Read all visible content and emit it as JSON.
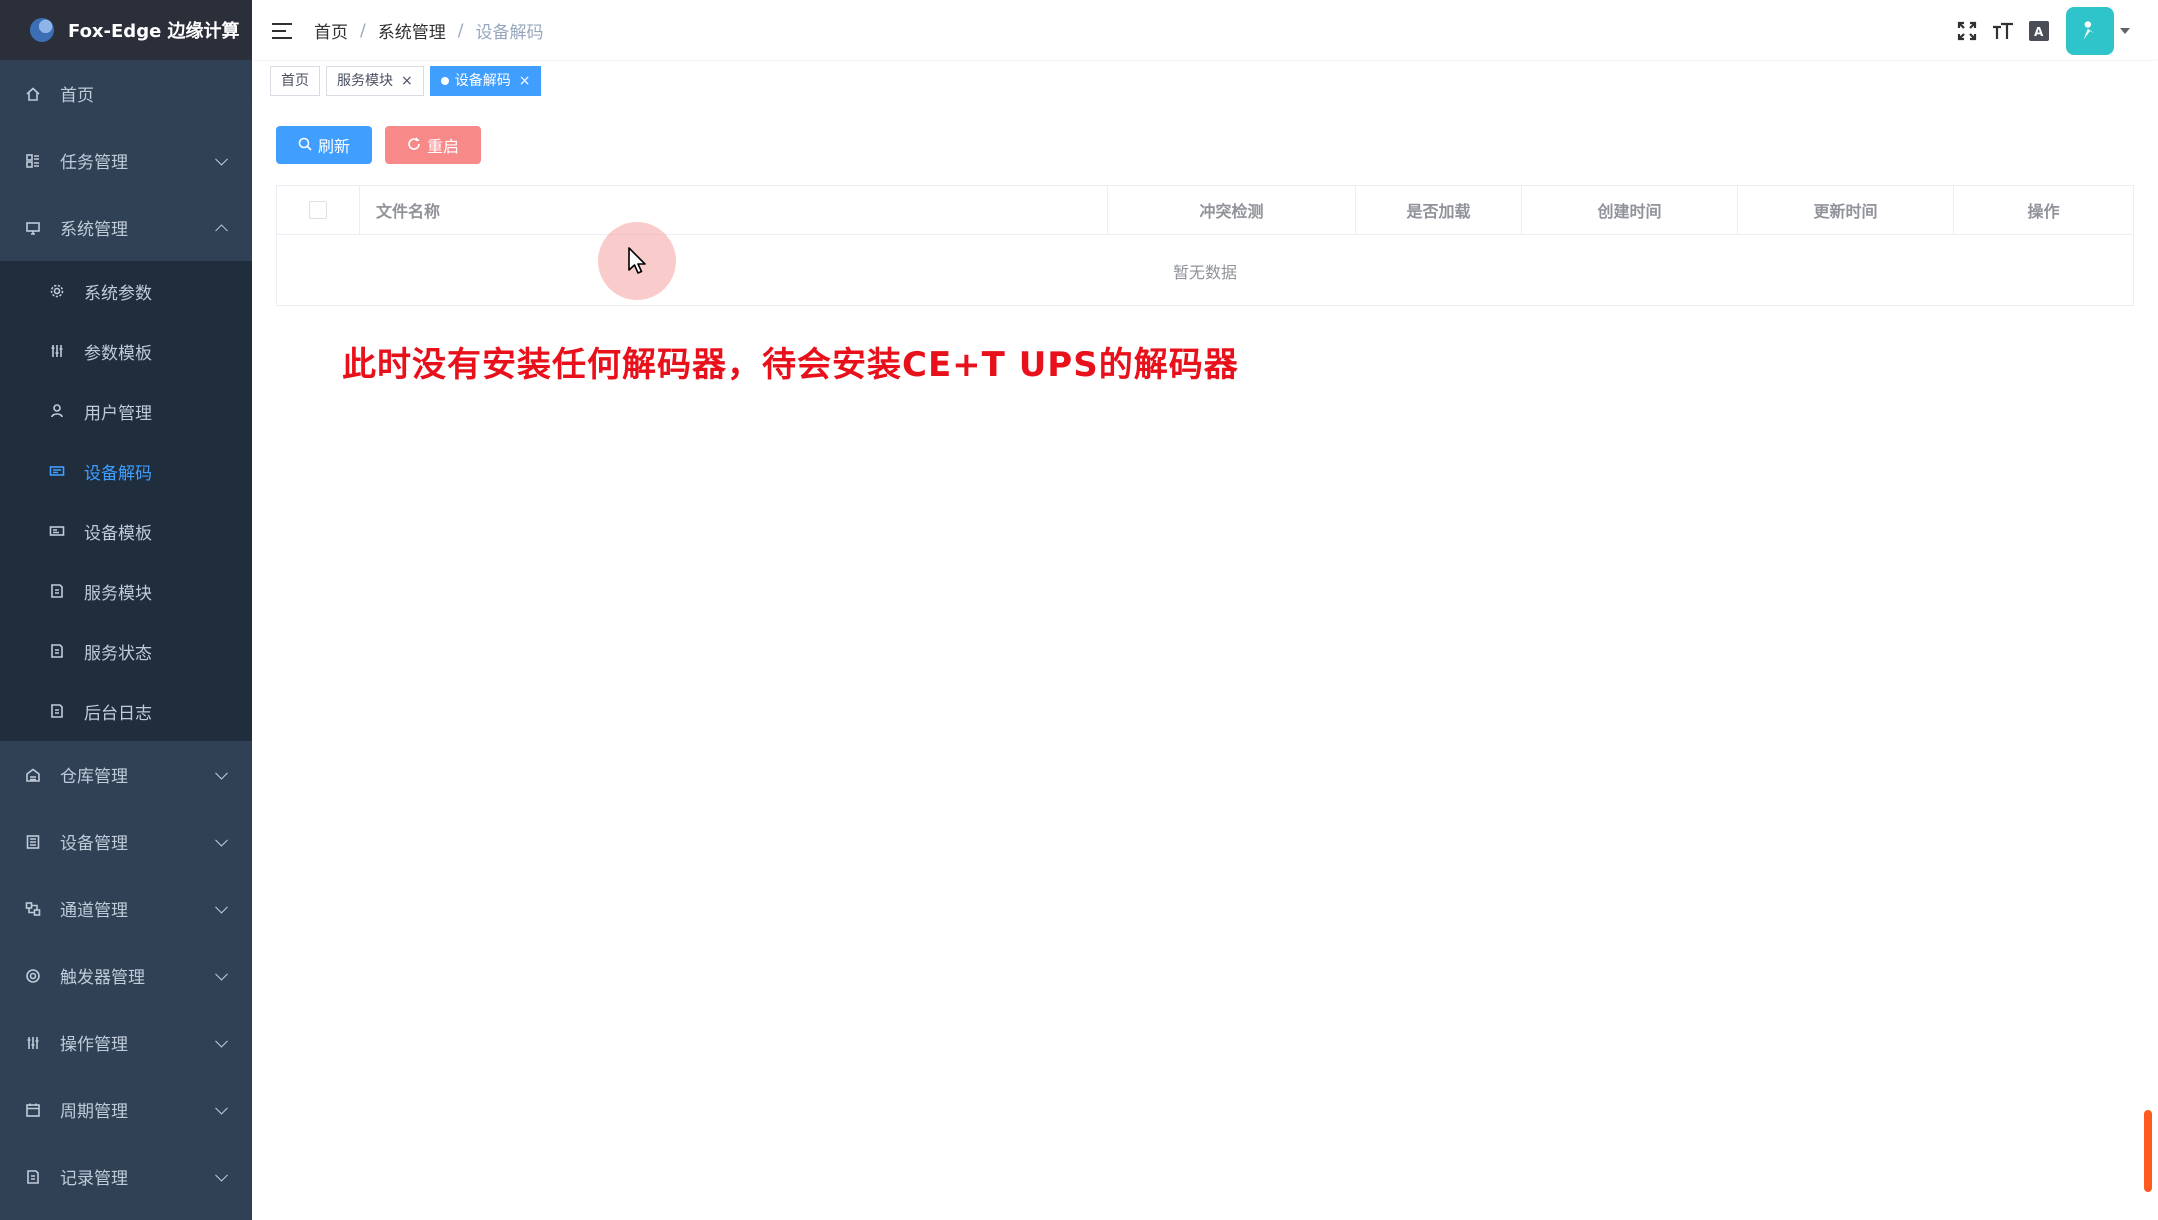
{
  "app": {
    "title": "Fox-Edge 边缘计算"
  },
  "sidebar": {
    "items": [
      {
        "label": "首页",
        "icon": "home-icon"
      },
      {
        "label": "任务管理",
        "icon": "task-icon"
      },
      {
        "label": "系统管理",
        "icon": "monitor-icon",
        "expanded": true,
        "children": [
          {
            "label": "系统参数",
            "icon": "gear-icon"
          },
          {
            "label": "参数模板",
            "icon": "sliders-icon"
          },
          {
            "label": "用户管理",
            "icon": "user-icon"
          },
          {
            "label": "设备解码",
            "icon": "code-icon",
            "active": true
          },
          {
            "label": "设备模板",
            "icon": "template-icon"
          },
          {
            "label": "服务模块",
            "icon": "module-icon"
          },
          {
            "label": "服务状态",
            "icon": "status-icon"
          },
          {
            "label": "后台日志",
            "icon": "log-icon"
          }
        ]
      },
      {
        "label": "仓库管理",
        "icon": "warehouse-icon"
      },
      {
        "label": "设备管理",
        "icon": "device-icon"
      },
      {
        "label": "通道管理",
        "icon": "channel-icon"
      },
      {
        "label": "触发器管理",
        "icon": "trigger-icon"
      },
      {
        "label": "操作管理",
        "icon": "operate-icon"
      },
      {
        "label": "周期管理",
        "icon": "calendar-icon"
      },
      {
        "label": "记录管理",
        "icon": "record-icon"
      }
    ]
  },
  "header": {
    "breadcrumb": [
      "首页",
      "系统管理",
      "设备解码"
    ],
    "breadcrumb_sep": "/"
  },
  "tags": [
    {
      "label": "首页",
      "closable": false
    },
    {
      "label": "服务模块",
      "closable": true
    },
    {
      "label": "设备解码",
      "closable": true,
      "active": true
    }
  ],
  "toolbar": {
    "refresh_label": "刷新",
    "restart_label": "重启"
  },
  "table": {
    "columns": [
      "文件名称",
      "冲突检测",
      "是否加载",
      "创建时间",
      "更新时间",
      "操作"
    ],
    "empty_text": "暂无数据"
  },
  "annotation": {
    "text": "此时没有安装任何解码器，待会安装CE+T UPS的解码器"
  },
  "colors": {
    "sidebar_bg": "#304156",
    "submenu_bg": "#1f2d3d",
    "primary": "#409eff",
    "danger": "#f78989",
    "annotation": "#e8101a"
  }
}
